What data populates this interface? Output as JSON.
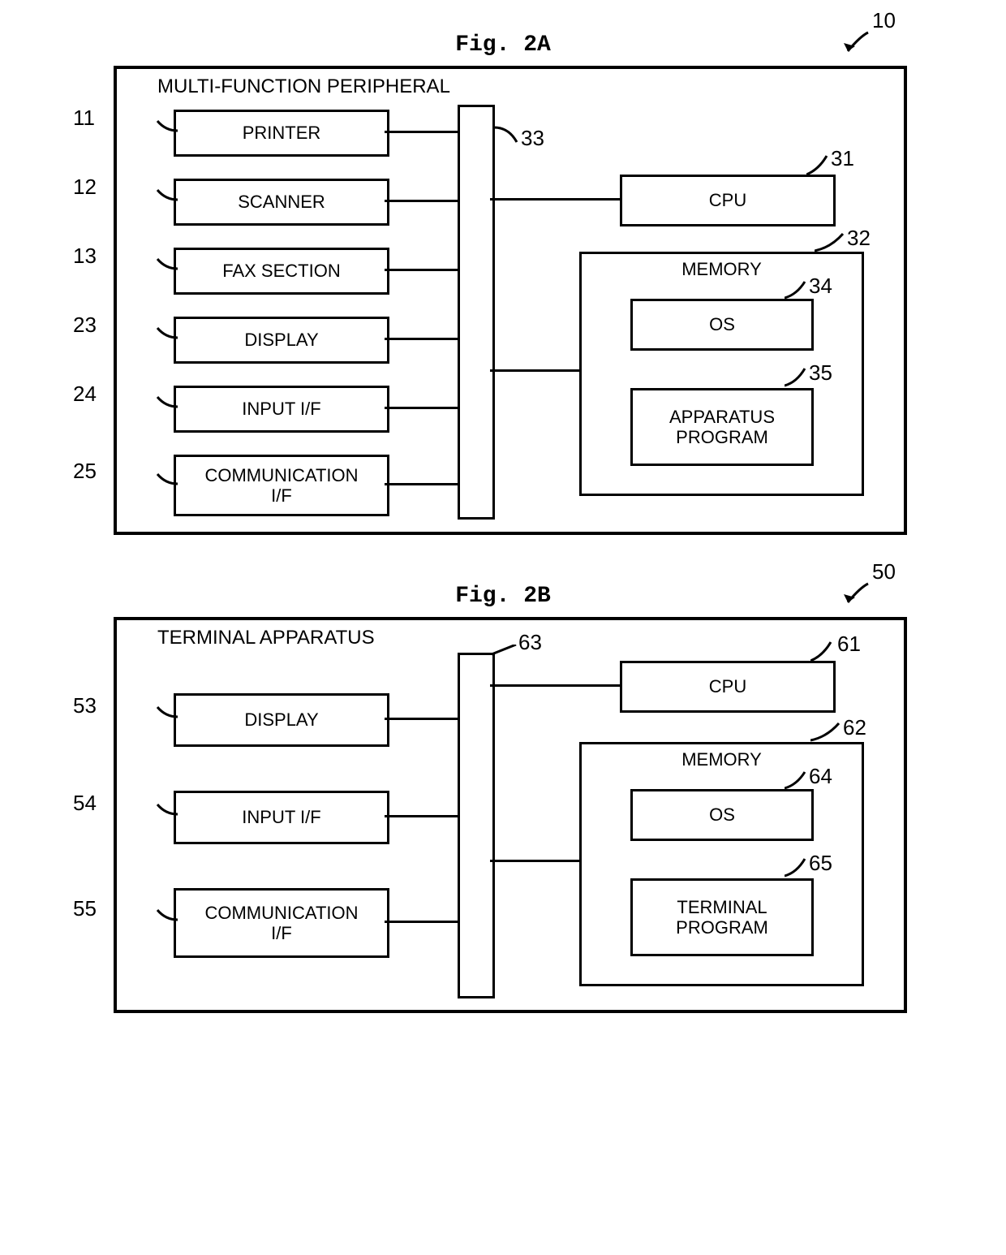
{
  "figA": {
    "title": "Fig. 2A",
    "outerRef": "10",
    "outerTitle": "MULTI-FUNCTION PERIPHERAL",
    "busRef": "33",
    "cpu": {
      "label": "CPU",
      "ref": "31"
    },
    "memory": {
      "label": "MEMORY",
      "ref": "32",
      "os": {
        "label": "OS",
        "ref": "34"
      },
      "prog": {
        "label": "APPARATUS\nPROGRAM",
        "ref": "35"
      }
    },
    "left": [
      {
        "label": "PRINTER",
        "ref": "11"
      },
      {
        "label": "SCANNER",
        "ref": "12"
      },
      {
        "label": "FAX SECTION",
        "ref": "13"
      },
      {
        "label": "DISPLAY",
        "ref": "23"
      },
      {
        "label": "INPUT I/F",
        "ref": "24"
      },
      {
        "label": "COMMUNICATION\nI/F",
        "ref": "25"
      }
    ]
  },
  "figB": {
    "title": "Fig. 2B",
    "outerRef": "50",
    "outerTitle": "TERMINAL APPARATUS",
    "busRef": "63",
    "cpu": {
      "label": "CPU",
      "ref": "61"
    },
    "memory": {
      "label": "MEMORY",
      "ref": "62",
      "os": {
        "label": "OS",
        "ref": "64"
      },
      "prog": {
        "label": "TERMINAL\nPROGRAM",
        "ref": "65"
      }
    },
    "left": [
      {
        "label": "DISPLAY",
        "ref": "53"
      },
      {
        "label": "INPUT I/F",
        "ref": "54"
      },
      {
        "label": "COMMUNICATION\nI/F",
        "ref": "55"
      }
    ]
  }
}
